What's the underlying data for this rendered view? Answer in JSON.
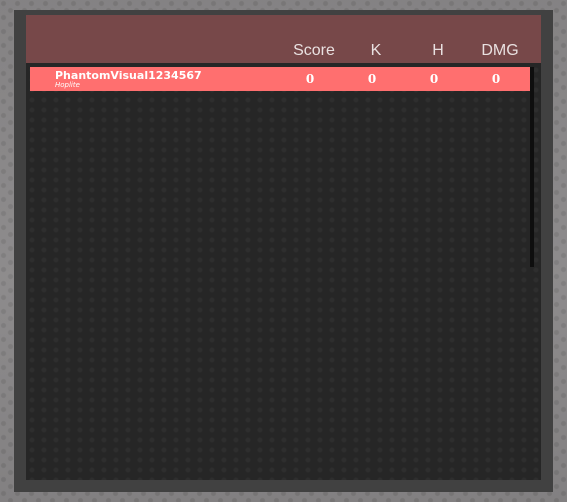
{
  "scoreboard": {
    "columns": {
      "score": "Score",
      "kills": "K",
      "headshots": "H",
      "damage": "DMG"
    },
    "players": [
      {
        "name": "PhantomVisual1234567",
        "class": "Hoplite",
        "score": "0",
        "kills": "0",
        "headshots": "0",
        "damage": "0",
        "row_color": "#ff6f6f"
      }
    ],
    "header_color": "#774849",
    "panel_color": "#262626"
  }
}
